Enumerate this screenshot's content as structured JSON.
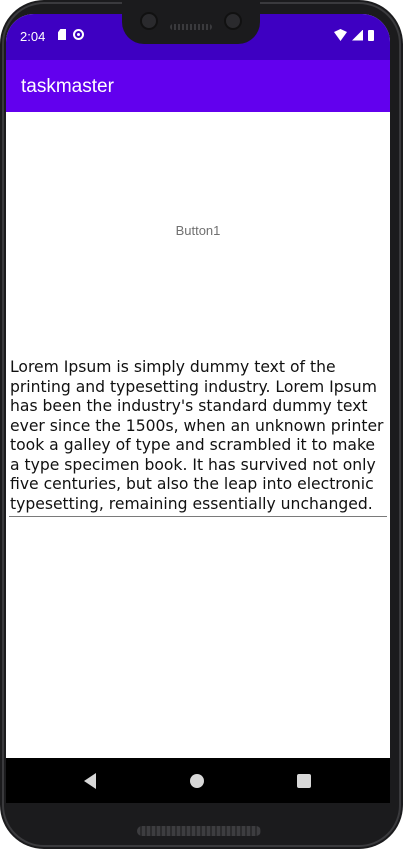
{
  "status_bar": {
    "time": "2:04",
    "left_icons": [
      "sd-card-icon",
      "sync-icon"
    ],
    "right_icons": [
      "wifi-icon",
      "cellular-signal-icon",
      "battery-icon"
    ],
    "background": "#3e00c2"
  },
  "app_bar": {
    "title": "taskmaster",
    "background": "#6200ee"
  },
  "main": {
    "button1_label": "Button1",
    "body_text": "Lorem Ipsum is simply dummy text of the printing and typesetting industry. Lorem Ipsum has been the industry's standard dummy text ever since the 1500s, when an unknown printer took a galley of type and scrambled it to make a type specimen book. It has survived not only five centuries, but also the leap into electronic typesetting, remaining essentially unchanged."
  },
  "nav_bar": {
    "buttons": [
      "back-icon",
      "home-icon",
      "recents-icon"
    ]
  }
}
